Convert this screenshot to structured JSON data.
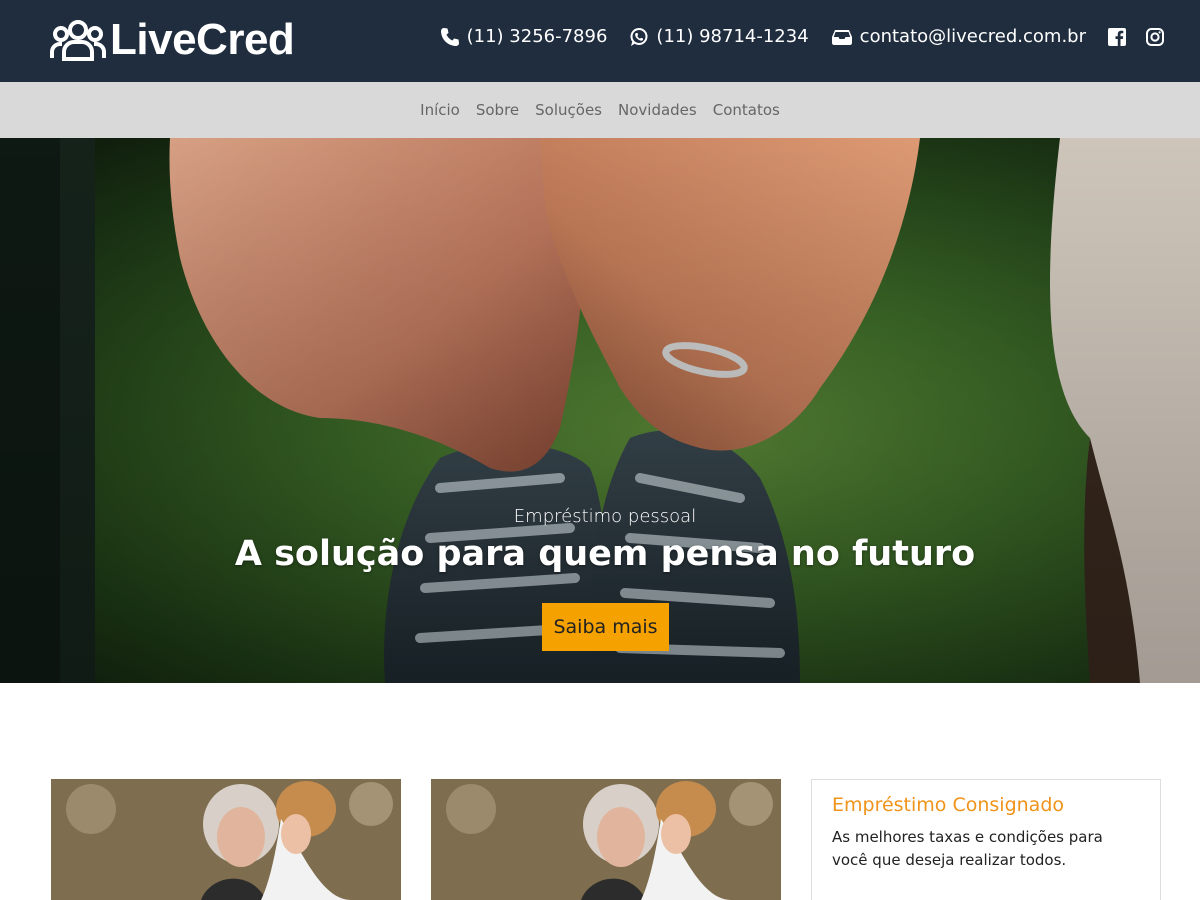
{
  "brand": {
    "name": "LiveCred",
    "icon": "group-users-icon"
  },
  "contacts": {
    "phone": "(11) 3256-7896",
    "whatsapp": "(11) 98714-1234",
    "email": "contato@livecred.com.br",
    "social": [
      "facebook-icon",
      "instagram-icon"
    ]
  },
  "nav": {
    "items": [
      {
        "label": "Início"
      },
      {
        "label": "Sobre"
      },
      {
        "label": "Soluções"
      },
      {
        "label": "Novidades"
      },
      {
        "label": "Contatos"
      }
    ]
  },
  "hero": {
    "kicker": "Empréstimo pessoal",
    "title": "A solução para quem pensa no futuro",
    "button_label": "Saiba mais"
  },
  "cards": [
    {
      "type": "image"
    },
    {
      "type": "image"
    },
    {
      "type": "text",
      "title": "Empréstimo Consignado",
      "description": "As melhores taxas e condições para você que deseja realizar todos."
    }
  ],
  "colors": {
    "header_bg": "#1f2d3f",
    "nav_bg": "#d9d9d9",
    "accent_button": "#f5a100",
    "card_title": "#f0931a"
  }
}
